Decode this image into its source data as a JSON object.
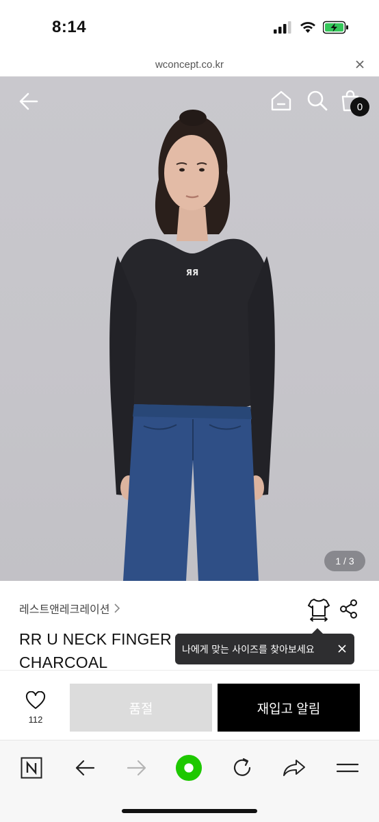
{
  "status_bar": {
    "time": "8:14"
  },
  "url_bar": {
    "url": "wconcept.co.kr"
  },
  "hero": {
    "cart_count": "0",
    "image_counter": "1 / 3"
  },
  "product": {
    "brand": "레스트앤레크레이션",
    "title": "RR U NECK FINGER HOLE LONG SLEEVE CHARCOAL"
  },
  "tooltip": {
    "text": "나에게 맞는 사이즈를 찾아보세요"
  },
  "actions": {
    "wish_count": "112",
    "soldout_label": "품절",
    "restock_label": "재입고 알림"
  },
  "colors": {
    "accent_green": "#1ec800",
    "battery_green": "#34c759"
  }
}
